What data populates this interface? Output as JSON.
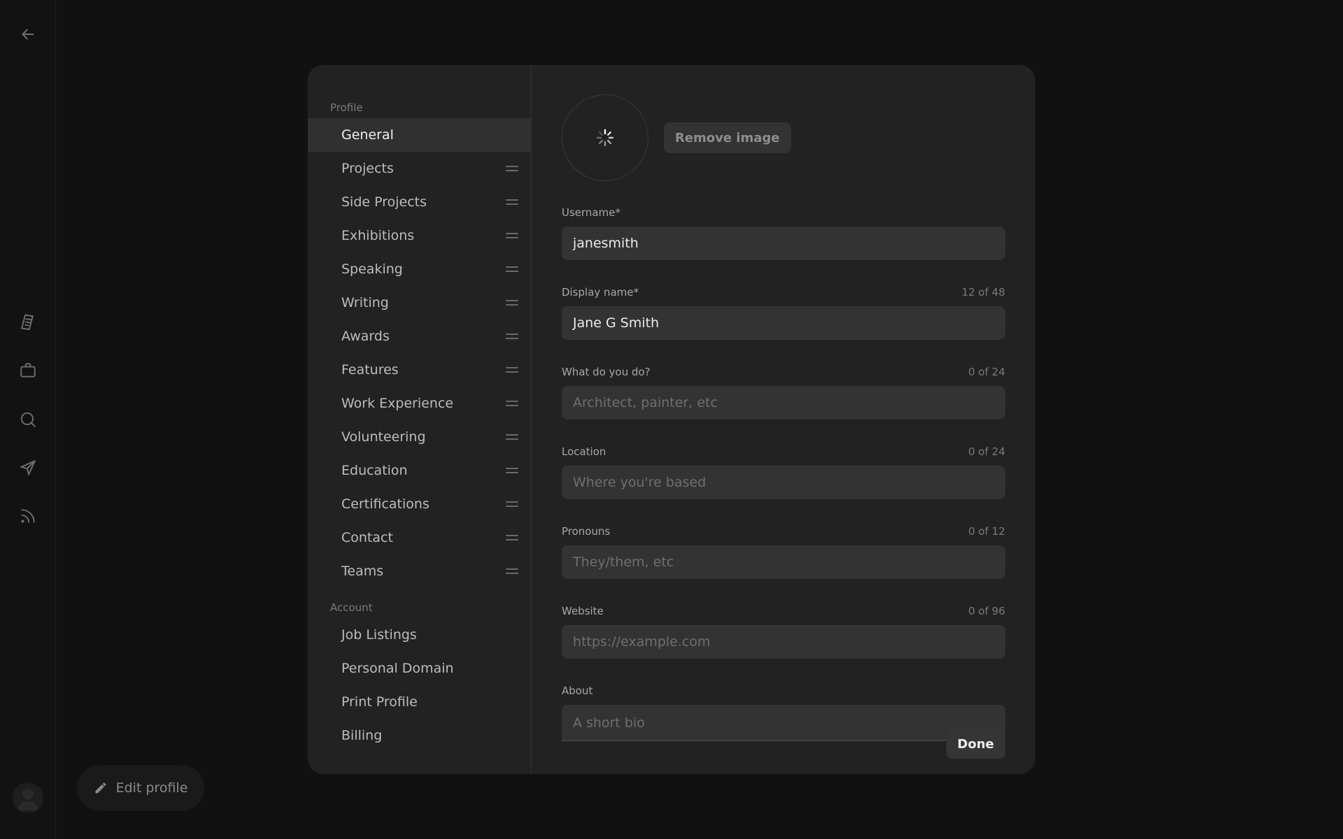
{
  "rail": {
    "icons": [
      "back-arrow-icon",
      "document-icon",
      "briefcase-icon",
      "search-icon",
      "send-icon",
      "rss-icon"
    ]
  },
  "edit_profile": {
    "label": "Edit profile"
  },
  "sidebar": {
    "profile_label": "Profile",
    "profile_items": [
      {
        "label": "General",
        "active": true
      },
      {
        "label": "Projects"
      },
      {
        "label": "Side Projects"
      },
      {
        "label": "Exhibitions"
      },
      {
        "label": "Speaking"
      },
      {
        "label": "Writing"
      },
      {
        "label": "Awards"
      },
      {
        "label": "Features"
      },
      {
        "label": "Work Experience"
      },
      {
        "label": "Volunteering"
      },
      {
        "label": "Education"
      },
      {
        "label": "Certifications"
      },
      {
        "label": "Contact"
      },
      {
        "label": "Teams"
      }
    ],
    "account_label": "Account",
    "account_items": [
      {
        "label": "Job Listings"
      },
      {
        "label": "Personal Domain"
      },
      {
        "label": "Print Profile"
      },
      {
        "label": "Billing"
      }
    ]
  },
  "main": {
    "remove_image_label": "Remove image",
    "fields": {
      "username": {
        "label": "Username*",
        "value": "janesmith"
      },
      "display_name": {
        "label": "Display name*",
        "count": "12 of 48",
        "value": "Jane G Smith"
      },
      "what_do": {
        "label": "What do you do?",
        "count": "0 of 24",
        "placeholder": "Architect, painter, etc"
      },
      "location": {
        "label": "Location",
        "count": "0 of 24",
        "placeholder": "Where you're based"
      },
      "pronouns": {
        "label": "Pronouns",
        "count": "0 of 12",
        "placeholder": "They/them, etc"
      },
      "website": {
        "label": "Website",
        "count": "0 of 96",
        "placeholder": "https://example.com"
      },
      "about": {
        "label": "About",
        "placeholder": "A short bio"
      }
    },
    "done_label": "Done"
  }
}
